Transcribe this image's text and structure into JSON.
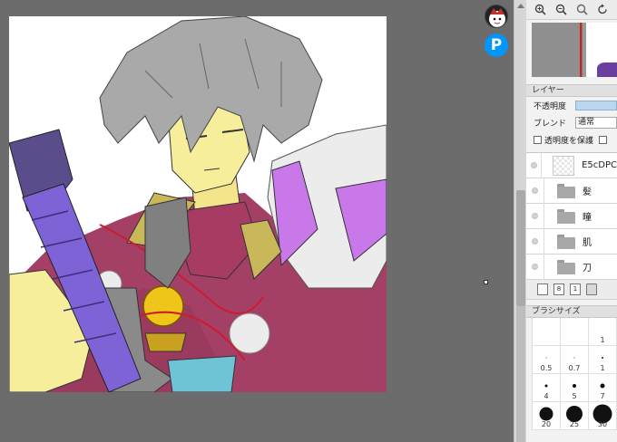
{
  "panel": {
    "layer_section_title": "レイヤー",
    "opacity_label": "不透明度",
    "blend_label": "ブレンド",
    "blend_value": "通常",
    "protect_alpha_label": "透明度を保護",
    "brush_size_title": "ブラシサイズ"
  },
  "layers": [
    {
      "name": "E5cDPC",
      "type": "layer"
    },
    {
      "name": "髪",
      "type": "folder"
    },
    {
      "name": "瞳",
      "type": "folder"
    },
    {
      "name": "肌",
      "type": "folder"
    },
    {
      "name": "刀",
      "type": "folder"
    }
  ],
  "layer_tools": [
    "",
    "8",
    "1",
    ""
  ],
  "brush_sizes": [
    "",
    "",
    "1",
    "0.5",
    "0.7",
    "1",
    "4",
    "5",
    "7",
    "20",
    "25",
    "30"
  ],
  "floating": {
    "pixiv_letter": "P"
  },
  "colors": {
    "accent_blue": "#0096fa",
    "slider_fill": "#bcd6ee",
    "nav_marker": "#d02020"
  }
}
